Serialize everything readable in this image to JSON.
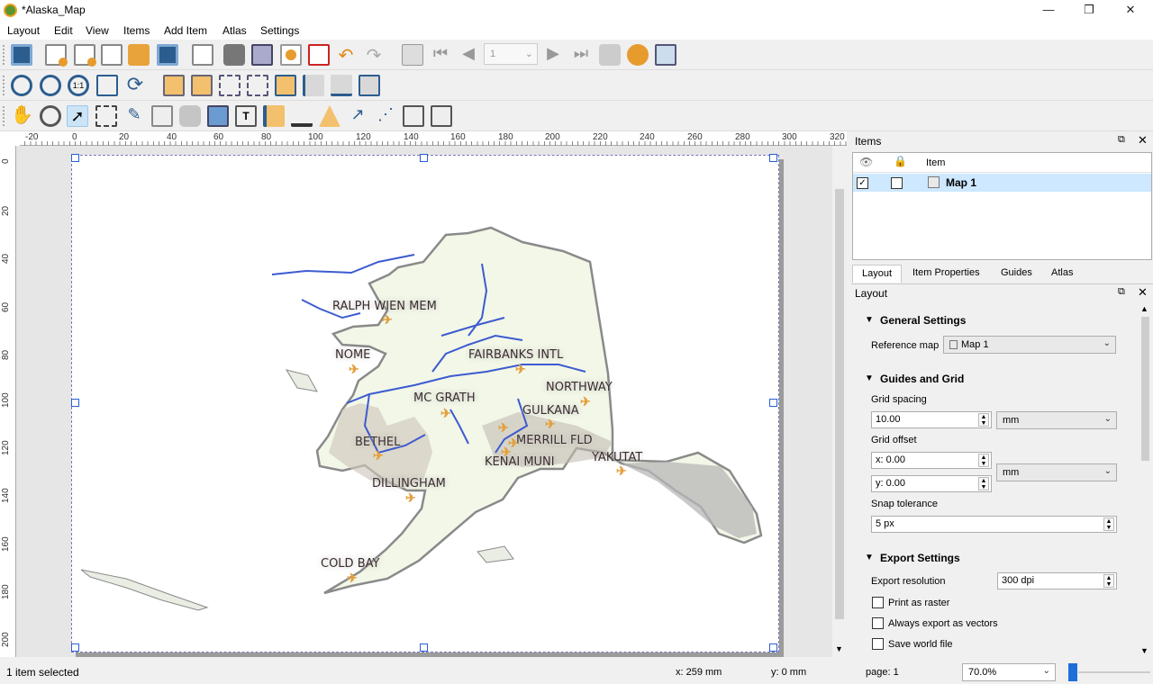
{
  "window": {
    "title": "*Alaska_Map",
    "minimize": "—",
    "maximize": "❐",
    "close": "✕"
  },
  "menu": [
    "Layout",
    "Edit",
    "View",
    "Items",
    "Add Item",
    "Atlas",
    "Settings"
  ],
  "nav": {
    "page_number": "1"
  },
  "ruler_top": [
    "-20",
    "0",
    "20",
    "40",
    "60",
    "80",
    "100",
    "120",
    "140",
    "160",
    "180",
    "200",
    "220",
    "240",
    "260",
    "280",
    "300",
    "320"
  ],
  "ruler_left": [
    "0",
    "20",
    "40",
    "60",
    "80",
    "100",
    "120",
    "140",
    "160",
    "180",
    "200"
  ],
  "map": {
    "cities": [
      "RALPH WIEN MEM",
      "NOME",
      "FAIRBANKS INTL",
      "NORTHWAY",
      "MC GRATH",
      "GULKANA",
      "BETHEL",
      "MERRILL FLD",
      "KENAI MUNI",
      "YAKUTAT",
      "DILLINGHAM",
      "COLD BAY"
    ]
  },
  "items_panel": {
    "title": "Items",
    "col_item": "Item",
    "rows": [
      {
        "name": "Map 1",
        "visible": true,
        "locked": false
      }
    ]
  },
  "tabs": [
    "Layout",
    "Item Properties",
    "Guides",
    "Atlas"
  ],
  "layout_panel": {
    "title": "Layout",
    "general": {
      "heading": "General Settings",
      "reference_map_label": "Reference map",
      "reference_map": "Map 1"
    },
    "guides": {
      "heading": "Guides and Grid",
      "grid_spacing_label": "Grid spacing",
      "grid_spacing": "10.00",
      "grid_spacing_unit": "mm",
      "grid_offset_label": "Grid offset",
      "offset_x": "x: 0.00",
      "offset_y": "y: 0.00",
      "offset_unit": "mm",
      "snap_label": "Snap tolerance",
      "snap": "5 px"
    },
    "export": {
      "heading": "Export Settings",
      "resolution_label": "Export resolution",
      "resolution": "300 dpi",
      "print_raster": "Print as raster",
      "vectors": "Always export as vectors",
      "world_file": "Save world file"
    }
  },
  "status": {
    "selected": "1 item selected",
    "x": "x: 259 mm",
    "y": "y: 0 mm",
    "page": "page: 1",
    "zoom": "70.0%"
  }
}
